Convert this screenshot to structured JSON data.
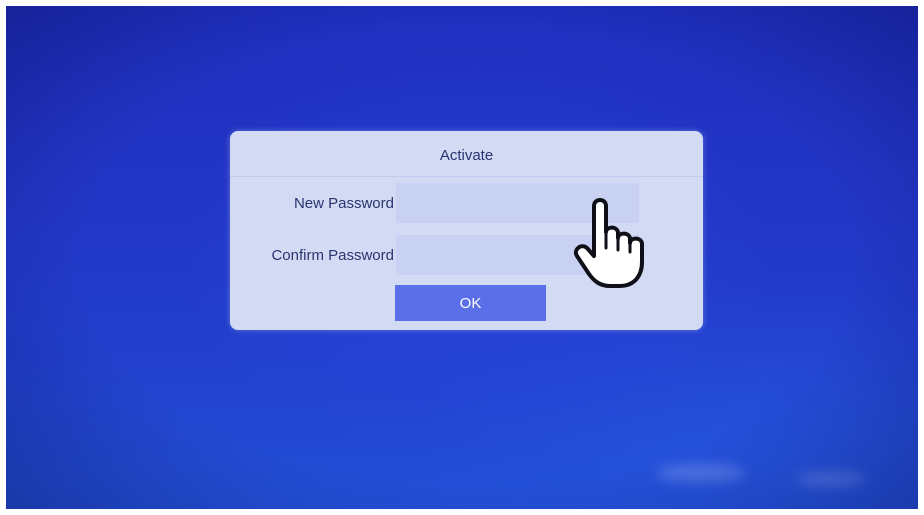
{
  "dialog": {
    "title": "Activate",
    "new_password": {
      "label": "New Password",
      "value": "",
      "placeholder": ""
    },
    "confirm_password": {
      "label": "Confirm Password",
      "value": "",
      "placeholder": ""
    },
    "ok_label": "OK"
  },
  "cursor": {
    "icon": "pointing-hand-icon"
  },
  "colors": {
    "background": "#2336c6",
    "dialog": "#d3daf3",
    "input": "#c9d1f2",
    "button": "#5b6fe8",
    "text": "#2a3470"
  }
}
